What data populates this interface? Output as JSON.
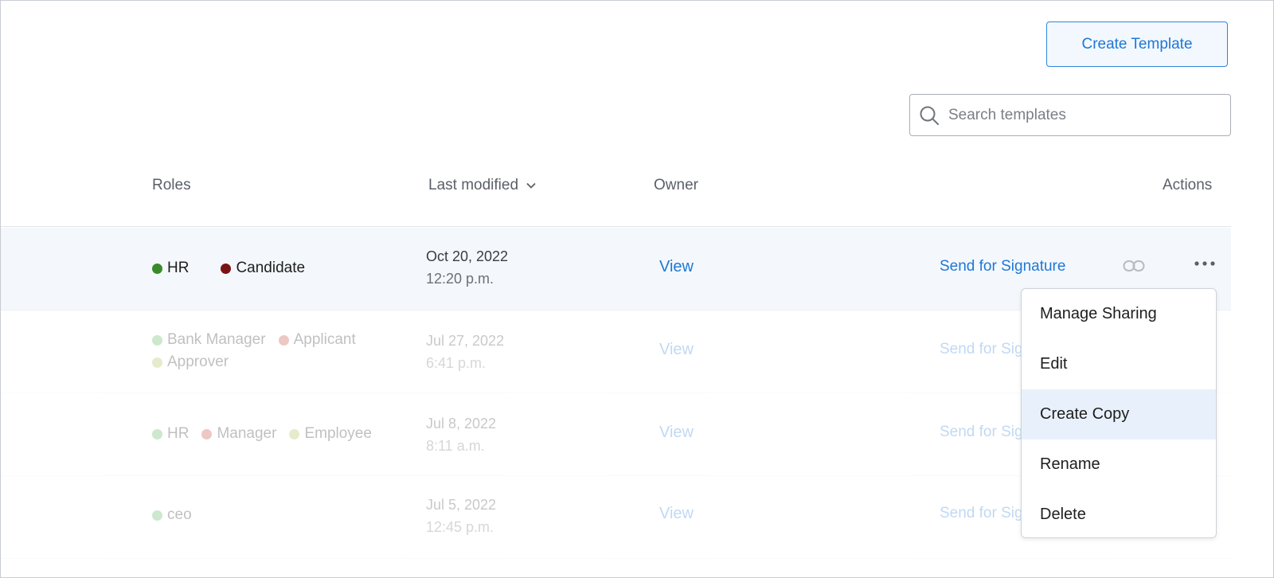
{
  "toolbar": {
    "create_label": "Create Template"
  },
  "search": {
    "placeholder": "Search templates"
  },
  "table": {
    "headers": {
      "roles": "Roles",
      "last_modified": "Last modified",
      "owner": "Owner",
      "actions": "Actions"
    },
    "rows": [
      {
        "roles": [
          {
            "label": "HR",
            "color": "#3a8a2b"
          },
          {
            "label": "Candidate",
            "color": "#7a1414"
          }
        ],
        "date": "Oct 20, 2022",
        "time": "12:20 p.m.",
        "owner": "View",
        "action": "Send for Signature"
      },
      {
        "roles": [
          {
            "label": "Bank Manager",
            "color": "#4caf50"
          },
          {
            "label": "Applicant",
            "color": "#c0392b"
          },
          {
            "label": "Approver",
            "color": "#a8b84a"
          }
        ],
        "date": "Jul 27, 2022",
        "time": "6:41 p.m.",
        "owner": "View",
        "action": "Send for Signature"
      },
      {
        "roles": [
          {
            "label": "HR",
            "color": "#4caf50"
          },
          {
            "label": "Manager",
            "color": "#c0392b"
          },
          {
            "label": "Employee",
            "color": "#a8b84a"
          }
        ],
        "date": "Jul 8, 2022",
        "time": "8:11 a.m.",
        "owner": "View",
        "action": "Send for Signature"
      },
      {
        "roles": [
          {
            "label": "ceo",
            "color": "#4caf50"
          }
        ],
        "date": "Jul 5, 2022",
        "time": "12:45 p.m.",
        "owner": "View",
        "action": "Send for Signature"
      }
    ]
  },
  "menu": {
    "items": [
      "Manage Sharing",
      "Edit",
      "Create Copy",
      "Rename",
      "Delete"
    ],
    "highlighted": "Create Copy"
  },
  "colors": {
    "accent": "#1f77d6",
    "active_row": "#f4f8fc",
    "menu_highlight": "#e8f1fb"
  }
}
